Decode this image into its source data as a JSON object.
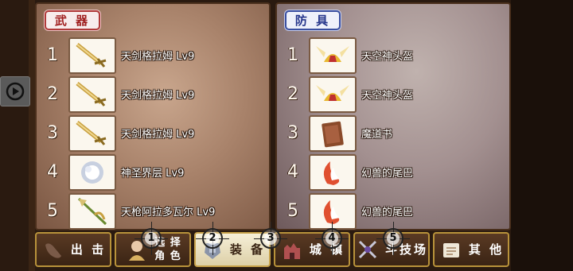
{
  "weapons": {
    "tab_label": "武 器",
    "items": [
      {
        "num": "1",
        "name": "天剑格拉姆 Lv9",
        "icon": "sword-icon"
      },
      {
        "num": "2",
        "name": "天剑格拉姆 Lv9",
        "icon": "sword-icon"
      },
      {
        "num": "3",
        "name": "天剑格拉姆 Lv9",
        "icon": "sword-icon"
      },
      {
        "num": "4",
        "name": "神圣界层 Lv9",
        "icon": "holy-orb-icon"
      },
      {
        "num": "5",
        "name": "天枪阿拉多瓦尔 Lv9",
        "icon": "spear-icon"
      }
    ]
  },
  "armor": {
    "tab_label": "防 具",
    "items": [
      {
        "num": "1",
        "name": "天空神头盔",
        "icon": "winged-helmet-icon"
      },
      {
        "num": "2",
        "name": "天空神头盔",
        "icon": "winged-helmet-icon"
      },
      {
        "num": "3",
        "name": "魔道书",
        "icon": "tome-icon"
      },
      {
        "num": "4",
        "name": "幻兽的尾巴",
        "icon": "beast-tail-icon"
      },
      {
        "num": "5",
        "name": "幻兽的尾巴",
        "icon": "beast-tail-icon"
      }
    ]
  },
  "nav": {
    "sortie": "出 击",
    "select_top": "选 择",
    "select_bottom": "角 色",
    "equip": "装 备",
    "town": "城 镇",
    "arena": "斗技场",
    "other": "其 他"
  },
  "markers": [
    "1",
    "2",
    "3",
    "4",
    "5"
  ],
  "colors": {
    "weapons_tag": "#a02020",
    "armor_tag": "#24348a",
    "active_nav": "#f6efd8"
  }
}
